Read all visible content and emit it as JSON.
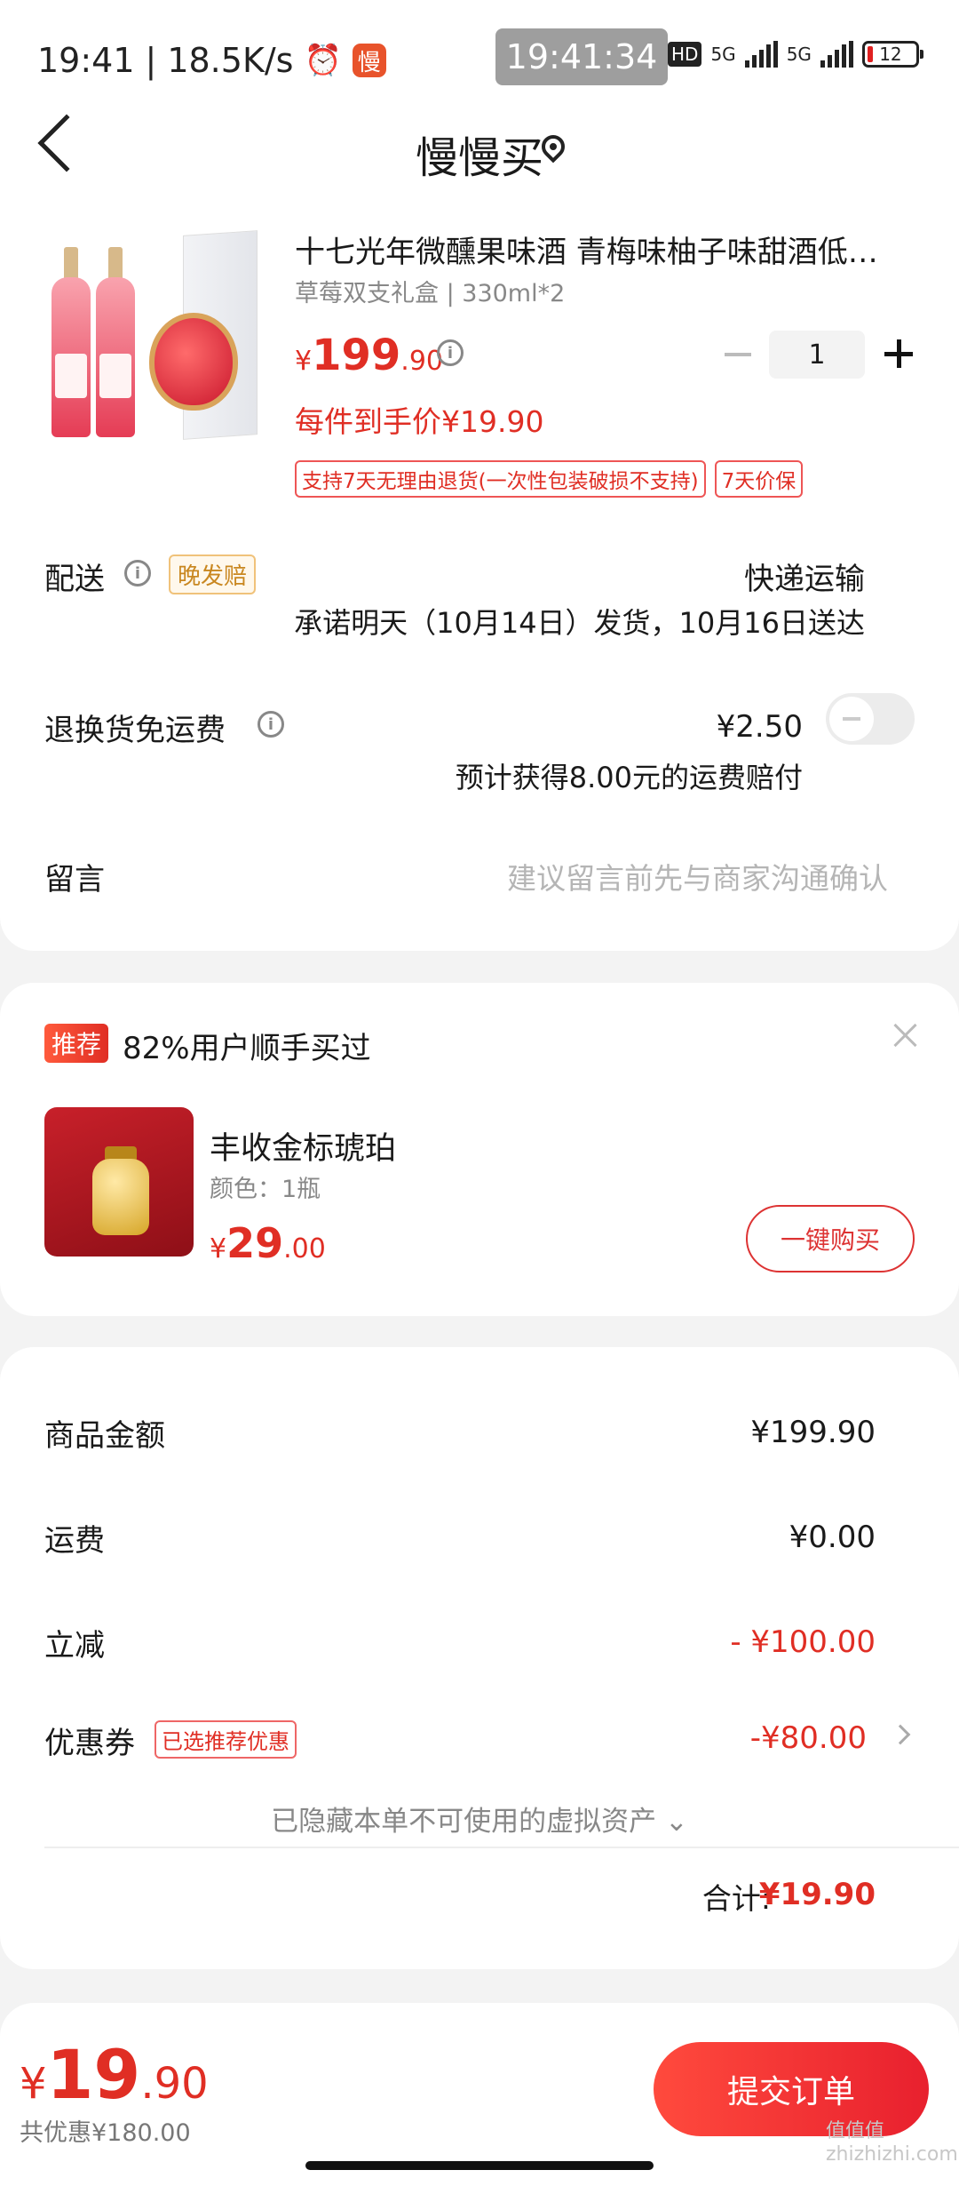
{
  "status_bar": {
    "time": "19:41",
    "speed": "18.5K/s",
    "app_badge": "慢",
    "center_clock": "19:41:34",
    "hd": "HD",
    "net1": "5G",
    "net2": "5G",
    "battery": "12"
  },
  "header": {
    "title": "慢慢买"
  },
  "product": {
    "title": "十七光年微醺果味酒 青梅味柚子味甜酒低…",
    "spec": "草莓双支礼盒 | 330ml*2",
    "price_yen": "¥",
    "price_int": "199",
    "price_dec": ".90",
    "quantity": "1",
    "unit_price": "每件到手价¥19.90",
    "tags": [
      "支持7天无理由退货(一次性包装破损不支持)",
      "7天价保"
    ]
  },
  "delivery": {
    "label": "配送",
    "tag": "晚发赔",
    "method": "快递运输",
    "promise": "承诺明天（10月14日）发货，10月16日送达"
  },
  "return_shipping": {
    "label": "退换货免运费",
    "price": "¥2.50",
    "note": "预计获得8.00元的运费赔付"
  },
  "message": {
    "label": "留言",
    "placeholder": "建议留言前先与商家沟通确认"
  },
  "recommend": {
    "badge": "推荐",
    "headline": "82%用户顺手买过",
    "item_name": "丰收金标琥珀",
    "item_spec": "颜色：1瓶",
    "price_yen": "¥",
    "price_int": "29",
    "price_dec": ".00",
    "button": "一键购买"
  },
  "summary": {
    "goods_label": "商品金额",
    "goods_value": "¥199.90",
    "shipping_label": "运费",
    "shipping_value": "¥0.00",
    "discount_label": "立减",
    "discount_value": "- ¥100.00",
    "coupon_label": "优惠券",
    "coupon_tag": "已选推荐优惠",
    "coupon_value": "-¥80.00",
    "hidden_note": "已隐藏本单不可使用的虚拟资产 ⌄",
    "total_label": "合计:",
    "total_value": "¥19.90"
  },
  "bottom_bar": {
    "price_yen": "¥",
    "price_int": "19",
    "price_dec": ".90",
    "saved": "共优惠¥180.00",
    "submit": "提交订单"
  },
  "watermark": "值值值 zhizhizhi.com",
  "colors": {
    "accent": "#e02e24",
    "background": "#f3f3f3"
  }
}
